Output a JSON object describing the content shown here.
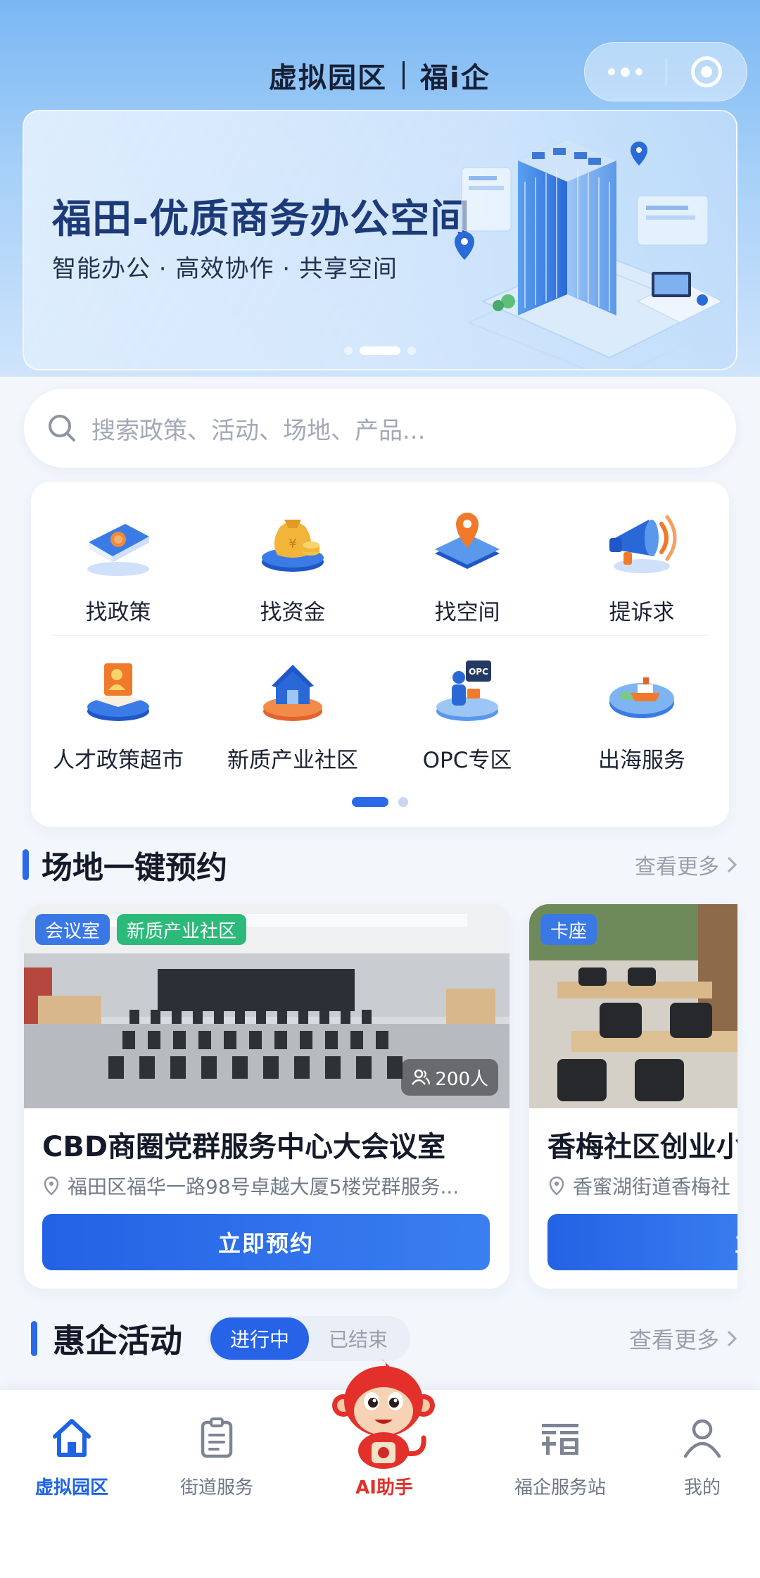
{
  "header": {
    "title_left": "虚拟园区",
    "title_right": "福i企"
  },
  "banner": {
    "title": "福田-优质商务办公空间",
    "subtitle": "智能办公 · 高效协作 · 共享空间",
    "slides": 3,
    "active_slide": 2
  },
  "search": {
    "placeholder": "搜索政策、活动、场地、产品..."
  },
  "services": {
    "items": [
      {
        "label": "找政策",
        "icon": "policy-book-icon"
      },
      {
        "label": "找资金",
        "icon": "money-bag-icon"
      },
      {
        "label": "找空间",
        "icon": "location-pin-icon"
      },
      {
        "label": "提诉求",
        "icon": "megaphone-icon"
      },
      {
        "label": "人才政策超市",
        "icon": "talent-book-icon"
      },
      {
        "label": "新质产业社区",
        "icon": "house-icon"
      },
      {
        "label": "OPC专区",
        "icon": "opc-person-icon"
      },
      {
        "label": "出海服务",
        "icon": "ship-island-icon"
      }
    ],
    "pages": 2,
    "active_page": 1
  },
  "venues": {
    "title": "场地一键预约",
    "more": "查看更多",
    "cards": [
      {
        "tags": [
          "会议室",
          "新质产业社区"
        ],
        "capacity": "200人",
        "name": "CBD商圈党群服务中心大会议室",
        "address": "福田区福华一路98号卓越大厦5楼党群服务...",
        "button": "立即预约"
      },
      {
        "tags": [
          "卡座"
        ],
        "name": "香梅社区创业小",
        "address": "香蜜湖街道香梅社",
        "button": "立"
      }
    ]
  },
  "activities": {
    "title": "惠企活动",
    "tab_active": "进行中",
    "tab_inactive": "已结束",
    "more": "查看更多"
  },
  "tabbar": {
    "items": [
      {
        "label": "虚拟园区",
        "icon": "home-icon",
        "active": true
      },
      {
        "label": "街道服务",
        "icon": "clipboard-icon"
      },
      {
        "label": "AI助手",
        "icon": "monkey-mascot-icon"
      },
      {
        "label": "福企服务站",
        "icon": "fuqi-logo-icon"
      },
      {
        "label": "我的",
        "icon": "user-icon"
      }
    ]
  },
  "colors": {
    "primary": "#2a6ae8",
    "tag_blue": "#3a78e6",
    "tag_green": "#2cba7a",
    "ai_red": "#e3302a",
    "page_bg": "#f3f6fb"
  }
}
